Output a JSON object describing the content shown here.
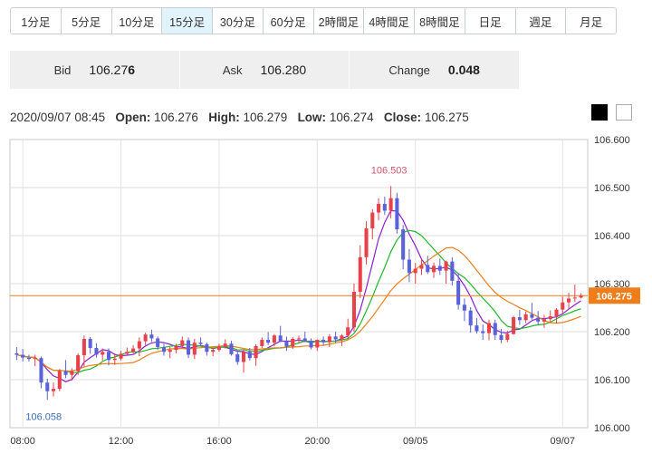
{
  "timeframe_tabs": [
    "1分足",
    "5分足",
    "10分足",
    "15分足",
    "30分足",
    "60分足",
    "2時間足",
    "4時間足",
    "8時間足",
    "日足",
    "週足",
    "月足"
  ],
  "active_tab_index": 3,
  "quote": {
    "bid_label": "Bid",
    "bid_main": "106.27",
    "bid_tail": "6",
    "ask_label": "Ask",
    "ask_main": "106.28",
    "ask_tail": "0",
    "change_label": "Change",
    "change_value": "0.048"
  },
  "ohlc_bar": {
    "datetime": "2020/09/07 08:45",
    "open_label": "Open:",
    "open": "106.276",
    "high_label": "High:",
    "high": "106.279",
    "low_label": "Low:",
    "low": "106.274",
    "close_label": "Close:",
    "close": "106.275"
  },
  "theme_options": [
    "dark",
    "light"
  ],
  "colors": {
    "up": "#e8414a",
    "down": "#5b62d8",
    "ma_fast": "#8a1fd1",
    "ma_mid": "#1fb82a",
    "ma_slow": "#ee7d1a",
    "price_line": "#ee7d1a",
    "tab_active_bg": "#e1f3fb"
  },
  "chart_data": {
    "type": "candlestick",
    "ylim": [
      106.0,
      106.6
    ],
    "y_ticks": [
      "106.600",
      "106.500",
      "106.400",
      "106.300",
      "106.200",
      "106.100",
      "106.000"
    ],
    "x_ticks": [
      "08:00",
      "12:00",
      "16:00",
      "20:00",
      "09/05",
      "09/07"
    ],
    "x_tick_index": [
      1,
      17,
      33,
      49,
      65,
      89
    ],
    "current_price": "106.275",
    "high_annotation": "106.503",
    "high_annotation_index": 61,
    "low_annotation": "106.058",
    "low_annotation_index": 5,
    "candles": [
      [
        106.155,
        106.168,
        106.141,
        106.152
      ],
      [
        106.152,
        106.164,
        106.138,
        106.146
      ],
      [
        106.146,
        106.152,
        106.138,
        106.143
      ],
      [
        106.143,
        106.152,
        106.128,
        106.145
      ],
      [
        106.145,
        106.148,
        106.082,
        106.094
      ],
      [
        106.094,
        106.102,
        106.058,
        106.076
      ],
      [
        106.076,
        106.094,
        106.065,
        106.081
      ],
      [
        106.081,
        106.122,
        106.076,
        106.118
      ],
      [
        106.118,
        106.141,
        106.103,
        106.11
      ],
      [
        106.11,
        106.124,
        106.098,
        106.118
      ],
      [
        106.118,
        106.155,
        106.11,
        106.151
      ],
      [
        106.151,
        106.192,
        106.128,
        106.185
      ],
      [
        106.185,
        106.189,
        106.154,
        106.166
      ],
      [
        106.166,
        106.176,
        106.146,
        106.152
      ],
      [
        106.152,
        106.165,
        106.14,
        106.158
      ],
      [
        106.158,
        106.165,
        106.13,
        106.141
      ],
      [
        106.141,
        106.155,
        106.131,
        106.144
      ],
      [
        106.144,
        106.16,
        106.14,
        106.154
      ],
      [
        106.154,
        106.167,
        106.151,
        106.158
      ],
      [
        106.158,
        106.172,
        106.155,
        106.165
      ],
      [
        106.165,
        106.188,
        106.149,
        106.18
      ],
      [
        106.18,
        106.198,
        106.172,
        106.194
      ],
      [
        106.194,
        106.204,
        106.179,
        106.186
      ],
      [
        106.186,
        106.19,
        106.162,
        106.168
      ],
      [
        106.168,
        106.175,
        106.15,
        106.158
      ],
      [
        106.158,
        106.168,
        106.145,
        106.162
      ],
      [
        106.162,
        106.175,
        106.155,
        106.17
      ],
      [
        106.17,
        106.19,
        106.165,
        106.182
      ],
      [
        106.182,
        106.188,
        106.145,
        106.152
      ],
      [
        106.152,
        106.185,
        106.143,
        106.177
      ],
      [
        106.177,
        106.188,
        106.17,
        106.174
      ],
      [
        106.174,
        106.177,
        106.15,
        106.158
      ],
      [
        106.158,
        106.165,
        106.149,
        106.162
      ],
      [
        106.162,
        106.175,
        106.158,
        106.169
      ],
      [
        106.169,
        106.184,
        106.165,
        106.175
      ],
      [
        106.175,
        106.181,
        106.15,
        106.153
      ],
      [
        106.153,
        106.16,
        106.131,
        106.137
      ],
      [
        106.137,
        106.162,
        106.115,
        106.158
      ],
      [
        106.158,
        106.166,
        106.14,
        106.145
      ],
      [
        106.145,
        106.174,
        106.129,
        106.17
      ],
      [
        106.17,
        106.188,
        106.166,
        106.183
      ],
      [
        106.183,
        106.199,
        106.172,
        106.177
      ],
      [
        106.177,
        106.195,
        106.17,
        106.192
      ],
      [
        106.192,
        106.212,
        106.178,
        106.18
      ],
      [
        106.18,
        106.19,
        106.16,
        106.169
      ],
      [
        106.169,
        106.189,
        106.164,
        106.185
      ],
      [
        106.185,
        106.192,
        106.176,
        106.186
      ],
      [
        106.186,
        106.2,
        106.178,
        106.181
      ],
      [
        106.181,
        106.186,
        106.163,
        106.167
      ],
      [
        106.167,
        106.184,
        106.16,
        106.183
      ],
      [
        106.183,
        106.19,
        106.171,
        106.178
      ],
      [
        106.178,
        106.195,
        106.168,
        106.19
      ],
      [
        106.19,
        106.2,
        106.177,
        106.184
      ],
      [
        106.184,
        106.195,
        106.17,
        106.192
      ],
      [
        106.192,
        106.227,
        106.185,
        106.209
      ],
      [
        106.209,
        106.3,
        106.2,
        106.283
      ],
      [
        106.283,
        106.38,
        106.27,
        106.355
      ],
      [
        106.355,
        106.43,
        106.34,
        106.415
      ],
      [
        106.415,
        106.455,
        106.392,
        106.448
      ],
      [
        106.448,
        106.478,
        106.432,
        106.466
      ],
      [
        106.466,
        106.481,
        106.443,
        106.452
      ],
      [
        106.452,
        106.503,
        106.436,
        106.478
      ],
      [
        106.478,
        106.489,
        106.404,
        106.413
      ],
      [
        106.413,
        106.422,
        106.33,
        106.35
      ],
      [
        106.35,
        106.372,
        106.303,
        106.322
      ],
      [
        106.322,
        106.343,
        106.3,
        106.331
      ],
      [
        106.331,
        106.351,
        106.318,
        106.339
      ],
      [
        106.339,
        106.358,
        106.32,
        106.324
      ],
      [
        106.324,
        106.344,
        106.312,
        106.337
      ],
      [
        106.337,
        106.352,
        106.318,
        106.327
      ],
      [
        106.327,
        106.348,
        106.3,
        106.346
      ],
      [
        106.346,
        106.355,
        106.296,
        106.306
      ],
      [
        106.306,
        106.321,
        106.246,
        106.256
      ],
      [
        106.256,
        106.269,
        106.222,
        106.244
      ],
      [
        106.244,
        106.251,
        106.198,
        106.213
      ],
      [
        106.213,
        106.228,
        106.196,
        106.201
      ],
      [
        106.201,
        106.215,
        106.183,
        106.197
      ],
      [
        106.197,
        106.225,
        106.182,
        106.218
      ],
      [
        106.218,
        106.225,
        106.183,
        106.193
      ],
      [
        106.193,
        106.206,
        106.176,
        106.183
      ],
      [
        106.183,
        106.202,
        106.178,
        106.195
      ],
      [
        106.195,
        106.233,
        106.194,
        106.23
      ],
      [
        106.23,
        106.245,
        106.214,
        106.224
      ],
      [
        106.224,
        106.242,
        106.218,
        106.236
      ],
      [
        106.236,
        106.26,
        106.225,
        106.229
      ],
      [
        106.229,
        106.243,
        106.214,
        106.221
      ],
      [
        106.221,
        106.235,
        106.208,
        106.226
      ],
      [
        106.226,
        106.244,
        106.22,
        106.232
      ],
      [
        106.232,
        106.249,
        106.217,
        106.246
      ],
      [
        106.246,
        106.273,
        106.238,
        106.261
      ],
      [
        106.261,
        106.281,
        106.247,
        106.269
      ],
      [
        106.269,
        106.298,
        106.262,
        106.271
      ],
      [
        106.271,
        106.28,
        106.269,
        106.275
      ]
    ]
  }
}
